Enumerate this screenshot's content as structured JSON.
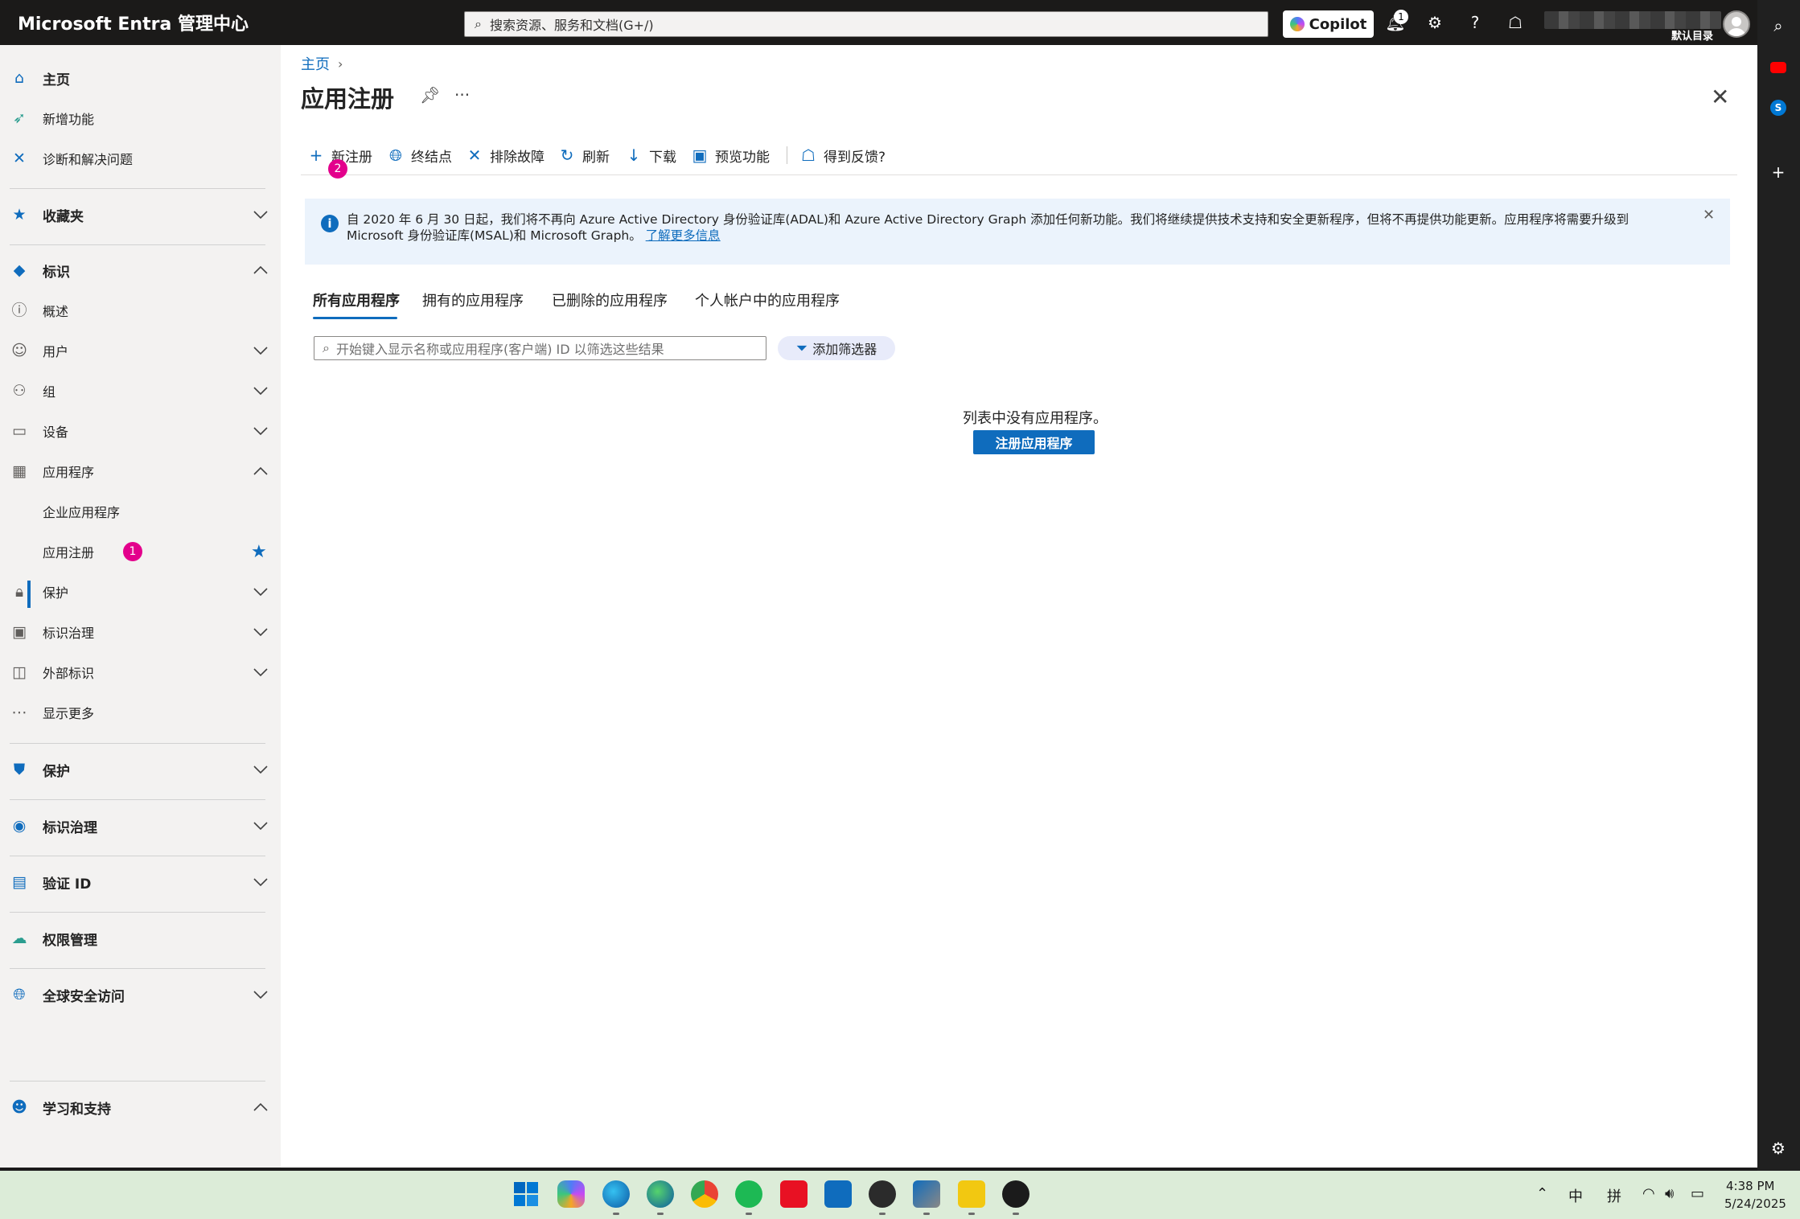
{
  "topbar": {
    "title": "Microsoft Entra 管理中心",
    "search_placeholder": "搜索资源、服务和文档(G+/)",
    "copilot_label": "Copilot",
    "notification_count": "1",
    "directory_label": "默认目录"
  },
  "sidebar": {
    "home": "主页",
    "whats_new": "新增功能",
    "diagnose": "诊断和解决问题",
    "favorites": "收藏夹",
    "identity": "标识",
    "overview": "概述",
    "users": "用户",
    "groups": "组",
    "devices": "设备",
    "applications": "应用程序",
    "enterprise_apps": "企业应用程序",
    "app_registrations": "应用注册",
    "app_reg_badge": "1",
    "protection_sub": "保护",
    "identity_governance_sub": "标识治理",
    "external_identities": "外部标识",
    "show_more": "显示更多",
    "protection": "保护",
    "identity_governance": "标识治理",
    "verified_id": "验证 ID",
    "permissions_management": "权限管理",
    "global_secure_access": "全球安全访问",
    "learn_support": "学习和支持",
    "collapse_glyph": "«"
  },
  "main": {
    "breadcrumb_home": "主页",
    "title": "应用注册",
    "toolbar": {
      "new_registration": "新注册",
      "new_registration_badge": "2",
      "endpoints": "终结点",
      "troubleshoot": "排除故障",
      "refresh": "刷新",
      "download": "下载",
      "preview_features": "预览功能",
      "feedback": "得到反馈?"
    },
    "banner": {
      "text": "自 2020 年 6 月 30 日起，我们将不再向 Azure Active Directory 身份验证库(ADAL)和 Azure Active Directory Graph 添加任何新功能。我们将继续提供技术支持和安全更新程序，但将不再提供功能更新。应用程序将需要升级到 Microsoft 身份验证库(MSAL)和 Microsoft Graph。",
      "link": "了解更多信息"
    },
    "tabs": [
      "所有应用程序",
      "拥有的应用程序",
      "已删除的应用程序",
      "个人帐户中的应用程序"
    ],
    "filter_placeholder": "开始键入显示名称或应用程序(客户端) ID 以筛选这些结果",
    "add_filter": "添加筛选器",
    "empty_message": "列表中没有应用程序。",
    "register_button": "注册应用程序"
  },
  "taskbar": {
    "tray_lang1": "中",
    "tray_lang2": "拼",
    "time": "4:38 PM",
    "date": "5/24/2025"
  },
  "colors": {
    "accent": "#0f6cbd",
    "badge": "#e3008c",
    "topbar": "#1b1a19",
    "sidebar_bg": "#f3f2f1",
    "taskbar_bg": "#dcecd8"
  }
}
